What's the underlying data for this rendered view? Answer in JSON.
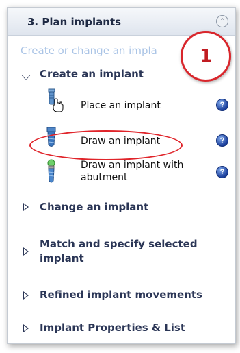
{
  "panel": {
    "title": "3. Plan implants",
    "subtitle": "Create or change an impla",
    "collapse_icon": "double-chevron-up-icon"
  },
  "create_section": {
    "label": "Create an implant",
    "expanded": true,
    "items": [
      {
        "label": "Place an implant",
        "icon": "implant-with-hand-cursor-icon",
        "help": "?"
      },
      {
        "label": "Draw an implant",
        "icon": "implant-icon",
        "help": "?"
      },
      {
        "label_line1": "Draw an implant with",
        "label_line2": "abutment",
        "icon": "implant-with-abutment-icon",
        "help": "?"
      }
    ]
  },
  "collapsed_sections": [
    {
      "label": "Change an implant"
    },
    {
      "label_line1": "Match and specify selected",
      "label_line2": "implant"
    },
    {
      "label": "Refined implant movements"
    },
    {
      "label": "Implant Properties & List"
    }
  ],
  "callout": {
    "number": "1"
  },
  "colors": {
    "highlight": "#e0242a",
    "subtitle": "#aac4e6",
    "section_text": "#2b3656",
    "help_icon": "#1b3f9c"
  }
}
